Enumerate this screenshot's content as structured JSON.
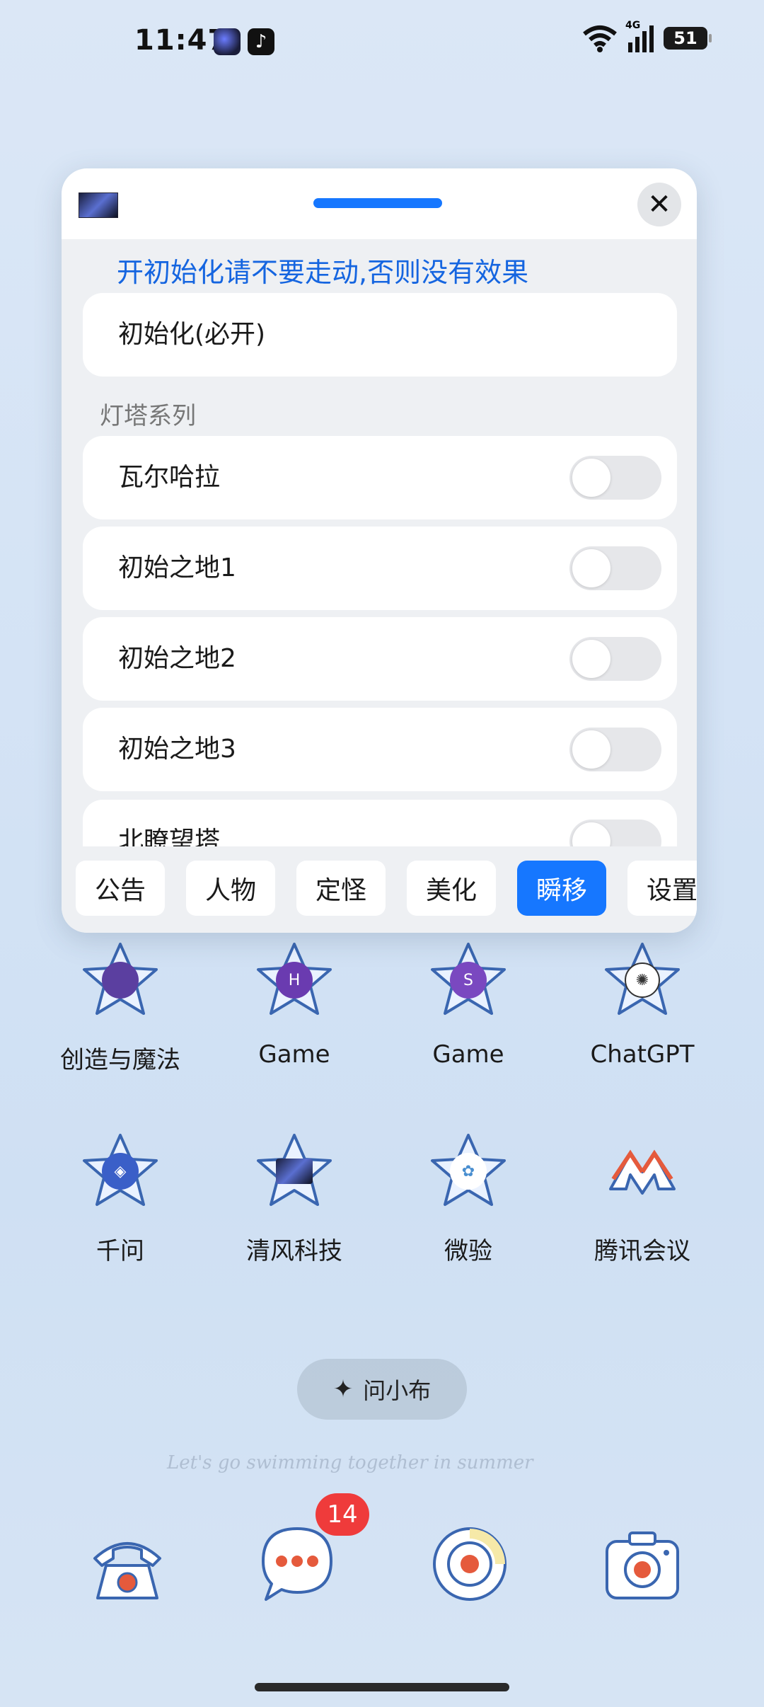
{
  "status_bar": {
    "time": "11:47",
    "battery": "51",
    "network": "4G"
  },
  "panel": {
    "notice": "开初始化请不要走动,否则没有效果",
    "init_item": "初始化(必开)",
    "section_title": "灯塔系列",
    "toggles": [
      {
        "label": "瓦尔哈拉",
        "on": false
      },
      {
        "label": "初始之地1",
        "on": false
      },
      {
        "label": "初始之地2",
        "on": false
      },
      {
        "label": "初始之地3",
        "on": false
      },
      {
        "label": "北瞭望塔",
        "on": false
      }
    ],
    "tabs": [
      {
        "label": "公告",
        "active": false
      },
      {
        "label": "人物",
        "active": false
      },
      {
        "label": "定怪",
        "active": false
      },
      {
        "label": "美化",
        "active": false
      },
      {
        "label": "瞬移",
        "active": true
      },
      {
        "label": "设置",
        "active": false
      }
    ],
    "accent": "#1677ff",
    "notice_color": "#1565e0"
  },
  "apps": [
    {
      "label": "创造与魔法",
      "icon": "game-icon"
    },
    {
      "label": "Game",
      "icon": "game-icon"
    },
    {
      "label": "Game",
      "icon": "game-icon"
    },
    {
      "label": "ChatGPT",
      "icon": "chatgpt-icon"
    },
    {
      "label": "千问",
      "icon": "qianwen-icon"
    },
    {
      "label": "清风科技",
      "icon": "qingfeng-icon"
    },
    {
      "label": "微验",
      "icon": "weiyan-icon"
    },
    {
      "label": "腾讯会议",
      "icon": "tencent-meeting-icon"
    }
  ],
  "assistant": {
    "label": "问小布"
  },
  "slogan": "Let's go swimming together in summer",
  "dock": {
    "messages_badge": "14",
    "items": [
      "phone-icon",
      "messages-icon",
      "browser-icon",
      "camera-icon"
    ]
  }
}
